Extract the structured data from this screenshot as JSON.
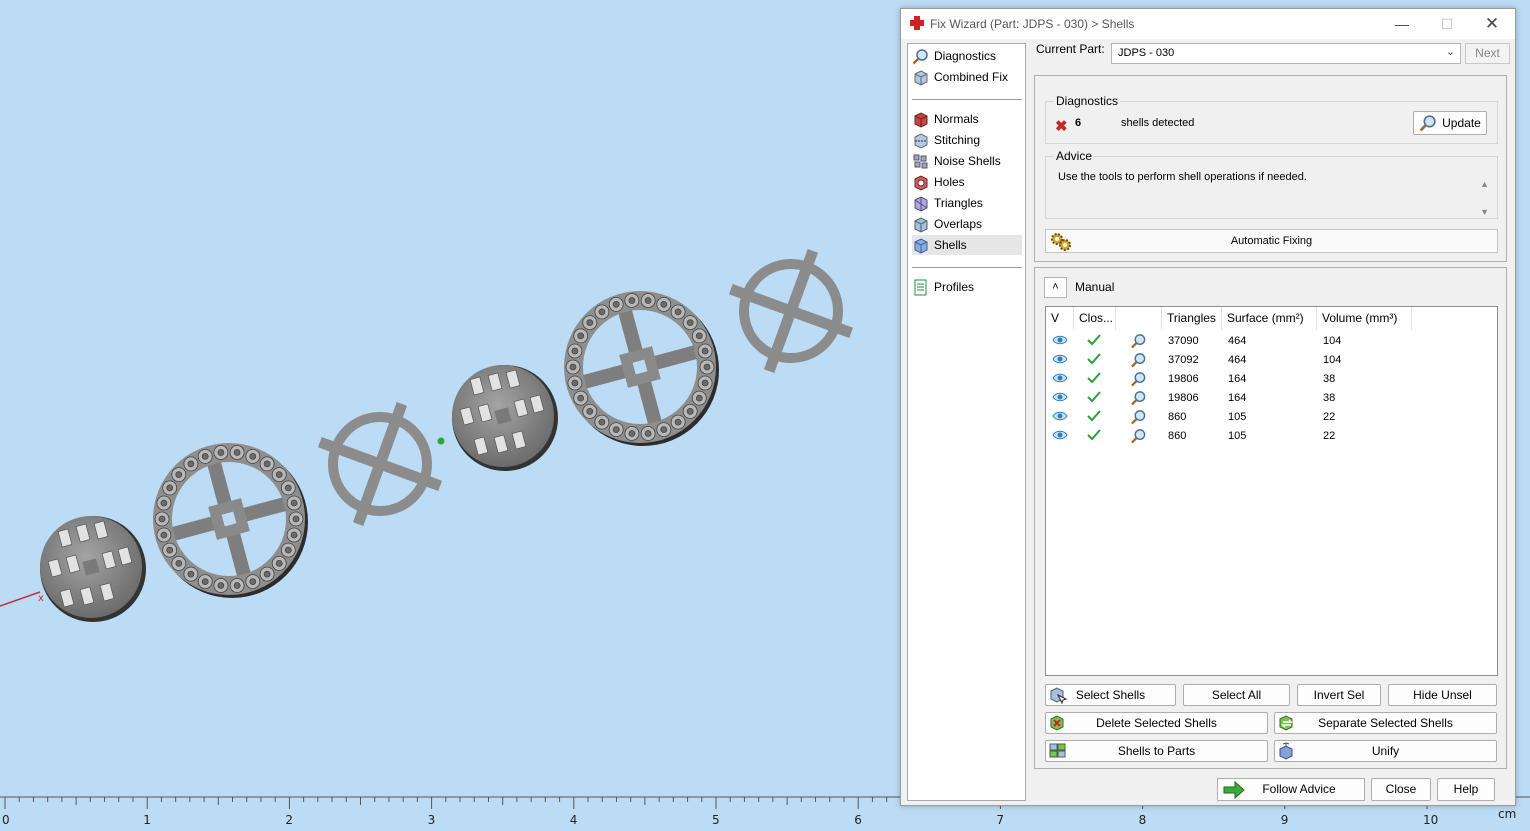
{
  "ruler": {
    "labels": [
      "0",
      "1",
      "2",
      "3",
      "4",
      "5",
      "6",
      "7",
      "8",
      "9",
      "10"
    ],
    "unit": "cm"
  },
  "dialog": {
    "title": "Fix Wizard (Part: JDPS - 030) > Shells",
    "current_part_label": "Current Part:",
    "current_part_value": "JDPS - 030",
    "next_label": "Next",
    "nav": {
      "top": [
        {
          "label": "Diagnostics",
          "icon": "magnifier-icon"
        },
        {
          "label": "Combined Fix",
          "icon": "combined-fix-icon"
        }
      ],
      "fixes": [
        {
          "label": "Normals",
          "icon": "normals-icon"
        },
        {
          "label": "Stitching",
          "icon": "stitching-icon"
        },
        {
          "label": "Noise Shells",
          "icon": "noise-shells-icon"
        },
        {
          "label": "Holes",
          "icon": "holes-icon"
        },
        {
          "label": "Triangles",
          "icon": "triangles-icon"
        },
        {
          "label": "Overlaps",
          "icon": "overlaps-icon"
        },
        {
          "label": "Shells",
          "icon": "shells-icon",
          "active": true
        }
      ],
      "bottom": [
        {
          "label": "Profiles",
          "icon": "profiles-icon"
        }
      ]
    },
    "diagnostics": {
      "title": "Diagnostics",
      "count": "6",
      "text": "shells detected",
      "update_label": "Update"
    },
    "advice": {
      "title": "Advice",
      "text": "Use the tools to perform shell operations if needed."
    },
    "automatic_fixing_label": "Automatic Fixing",
    "manual": {
      "label": "Manual",
      "columns": [
        "V",
        "Clos...",
        "",
        "Triangles",
        "Surface (mm²)",
        "Volume (mm³)"
      ],
      "rows": [
        {
          "triangles": "37090",
          "surface": "464",
          "volume": "104"
        },
        {
          "triangles": "37092",
          "surface": "464",
          "volume": "104"
        },
        {
          "triangles": "19806",
          "surface": "164",
          "volume": "38"
        },
        {
          "triangles": "19806",
          "surface": "164",
          "volume": "38"
        },
        {
          "triangles": "860",
          "surface": "105",
          "volume": "22"
        },
        {
          "triangles": "860",
          "surface": "105",
          "volume": "22"
        }
      ],
      "buttons": {
        "select_shells": "Select Shells",
        "select_all": "Select All",
        "invert_sel": "Invert Sel",
        "hide_unsel": "Hide Unsel",
        "delete_selected": "Delete Selected Shells",
        "separate_selected": "Separate Selected Shells",
        "shells_to_parts": "Shells to Parts",
        "unify": "Unify"
      }
    },
    "footer": {
      "follow_advice": "Follow Advice",
      "close": "Close",
      "help": "Help"
    },
    "colors": {
      "accent_green": "#2e9d3a",
      "error_red": "#c62828",
      "eye_blue": "#2d7fc1"
    }
  }
}
